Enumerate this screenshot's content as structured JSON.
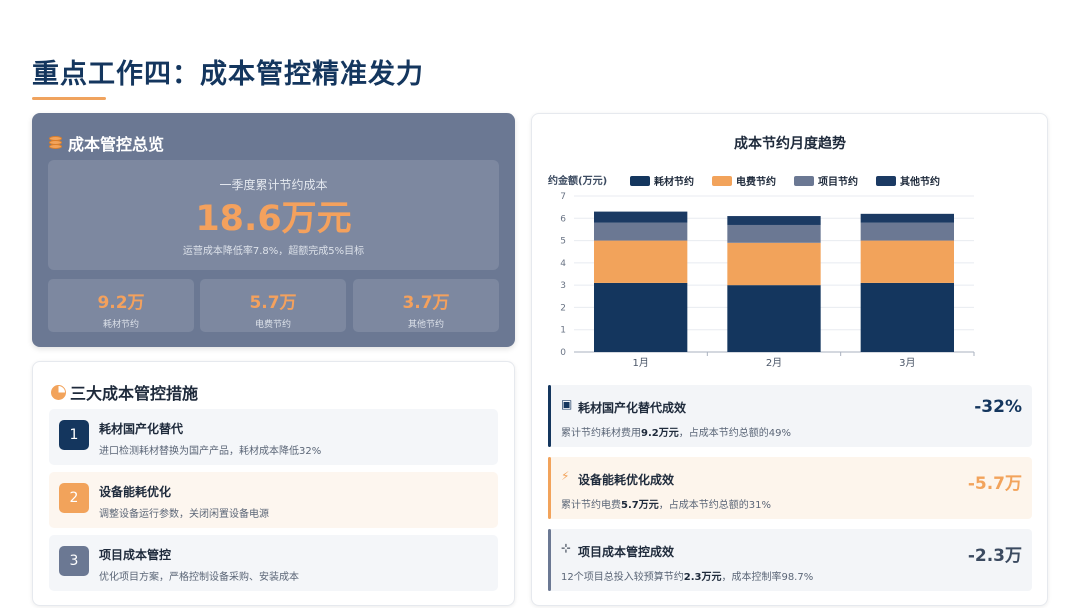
{
  "title": "重点工作四：成本管控精准发力",
  "colors": {
    "navy": "#14365e",
    "orange": "#f2a35b",
    "slate": "#6b7893",
    "dark": "#1b3a63"
  },
  "overview": {
    "heading": "成本管控总览",
    "icon": "coins-icon",
    "big_label": "一季度累计节约成本",
    "big_value": "18.6万元",
    "note": "运营成本降低率7.8%，超额完成5%目标",
    "stats": [
      {
        "value": "9.2万",
        "label": "耗材节约"
      },
      {
        "value": "5.7万",
        "label": "电费节约"
      },
      {
        "value": "3.7万",
        "label": "其他节约"
      }
    ]
  },
  "measures": {
    "heading": "三大成本管控措施",
    "icon": "pie-chart-icon",
    "items": [
      {
        "num": "1",
        "title": "耗材国产化替代",
        "desc": "进口检测耗材替换为国产产品，耗材成本降低32%"
      },
      {
        "num": "2",
        "title": "设备能耗优化",
        "desc": "调整设备运行参数，关闭闲置设备电源"
      },
      {
        "num": "3",
        "title": "项目成本管控",
        "desc": "优化项目方案，严格控制设备采购、安装成本"
      }
    ]
  },
  "chart_data": {
    "type": "bar",
    "stacked": true,
    "title": "成本节约月度趋势",
    "ylabel": "约金额(万元)",
    "xlabel": "",
    "categories": [
      "1月",
      "2月",
      "3月"
    ],
    "ylim": [
      0,
      7
    ],
    "yticks": [
      0,
      1,
      2,
      3,
      4,
      5,
      6,
      7
    ],
    "legend_position": "top",
    "grid": true,
    "series": [
      {
        "name": "耗材节约",
        "color": "#14365e",
        "values": [
          3.1,
          3.0,
          3.1
        ]
      },
      {
        "name": "电费节约",
        "color": "#f2a35b",
        "values": [
          1.9,
          1.9,
          1.9
        ]
      },
      {
        "name": "项目节约",
        "color": "#6b7893",
        "values": [
          0.8,
          0.8,
          0.8
        ]
      },
      {
        "name": "其他节约",
        "color": "#1b3a63",
        "values": [
          0.5,
          0.4,
          0.4
        ]
      }
    ]
  },
  "effects": [
    {
      "icon": "boxes-icon",
      "glyph": "▣",
      "title": "耗材国产化替代成效",
      "value": "-32%",
      "desc_pre": "累计节约耗材费用",
      "desc_bold": "9.2万元",
      "desc_post": "，占成本节约总额的49%",
      "accent": "#14365e",
      "value_color": "#14365e"
    },
    {
      "icon": "lightning-icon",
      "glyph": "⚡",
      "title": "设备能耗优化成效",
      "value": "-5.7万",
      "desc_pre": "累计节约电费",
      "desc_bold": "5.7万元",
      "desc_post": "，占成本节约总额的31%",
      "accent": "#f2a35b",
      "value_color": "#f2a35b"
    },
    {
      "icon": "project-icon",
      "glyph": "⊹",
      "title": "项目成本管控成效",
      "value": "-2.3万",
      "desc_pre": "12个项目总投入较预算节约",
      "desc_bold": "2.3万元",
      "desc_post": "，成本控制率98.7%",
      "accent": "#6b7893",
      "value_color": "#3b4a60"
    }
  ]
}
